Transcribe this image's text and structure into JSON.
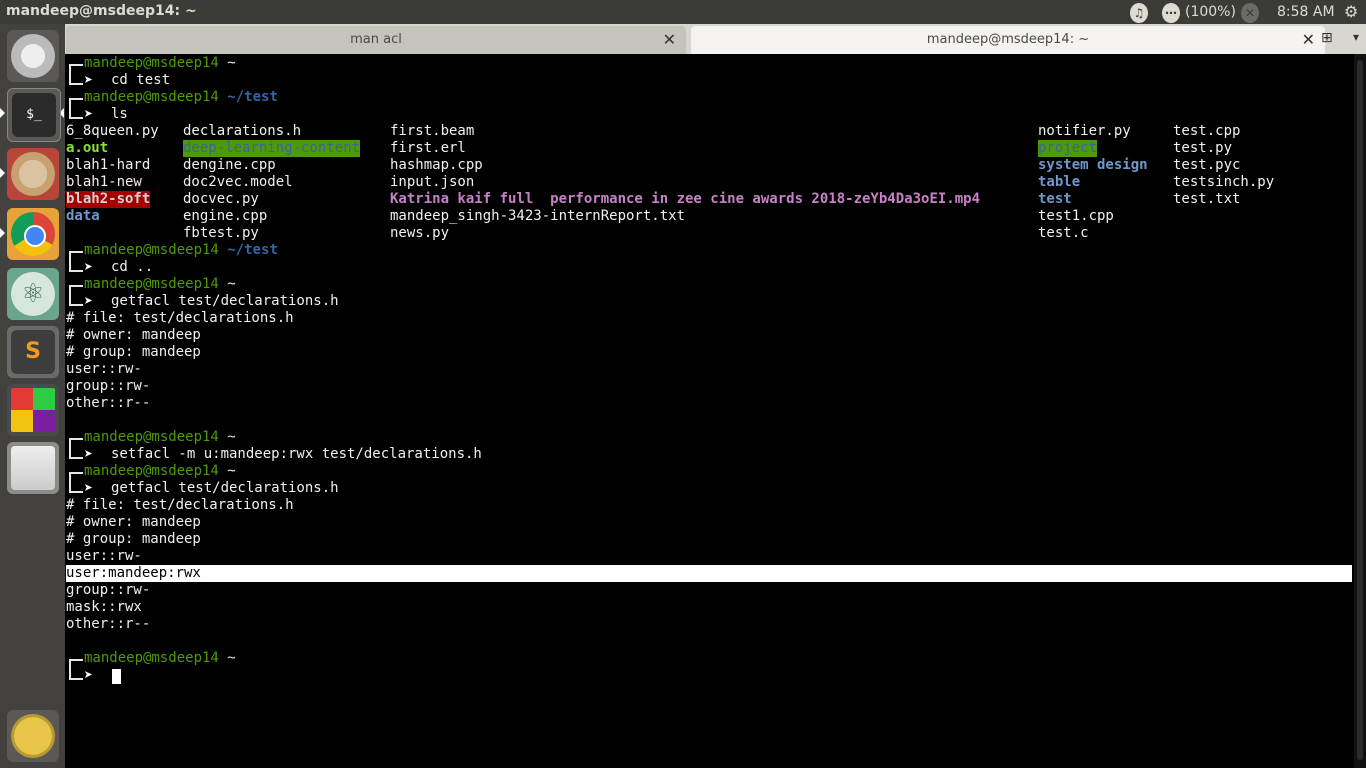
{
  "topbar": {
    "window_title": "mandeep@msdeep14: ~",
    "battery": "(100%)",
    "clock": "8:58 AM"
  },
  "launcher": {
    "items": [
      "ubuntu-dash-icon",
      "terminal-icon",
      "files-icon",
      "chrome-icon",
      "atom-icon",
      "sublime-text-icon",
      "rubiks-cube-icon",
      "drive-icon",
      "trash-icon"
    ]
  },
  "tabs": [
    {
      "label": "man acl"
    },
    {
      "label": "mandeep@msdeep14: ~"
    }
  ],
  "prompts": [
    {
      "user": "mandeep@msdeep14",
      "path": "~",
      "command": "cd test"
    },
    {
      "user": "mandeep@msdeep14",
      "path": "~/test",
      "command": "ls"
    },
    {
      "user": "mandeep@msdeep14",
      "path": "~/test",
      "command": "cd .."
    },
    {
      "user": "mandeep@msdeep14",
      "path": "~",
      "command": "getfacl test/declarations.h"
    },
    {
      "user": "mandeep@msdeep14",
      "path": "~",
      "command": "setfacl -m u:mandeep:rwx test/declarations.h"
    },
    {
      "user": "mandeep@msdeep14",
      "path": "~",
      "command": "getfacl test/declarations.h"
    },
    {
      "user": "mandeep@msdeep14",
      "path": "~",
      "command": ""
    }
  ],
  "ls_output": {
    "col1": [
      "6_8queen.py",
      "a.out",
      "blah1-hard",
      "blah1-new",
      "blah2-soft",
      "data"
    ],
    "col2": [
      "declarations.h",
      "deep-learning-content",
      "dengine.cpp",
      "doc2vec.model",
      "docvec.py",
      "engine.cpp",
      "fbtest.py"
    ],
    "col3": [
      "first.beam",
      "first.erl",
      "hashmap.cpp",
      "input.json",
      "Katrina kaif full  performance in zee cine awards 2018-zeYb4Da3oEI.mp4",
      "mandeep_singh-3423-internReport.txt",
      "news.py"
    ],
    "col4": [
      "notifier.py",
      "project",
      "system design",
      "table",
      "test",
      "test1.cpp",
      "test.c"
    ],
    "col5": [
      "test.cpp",
      "test.py",
      "test.pyc",
      "testsinch.py",
      "test.txt"
    ]
  },
  "getfacl1": [
    "# file: test/declarations.h",
    "# owner: mandeep",
    "# group: mandeep",
    "user::rw-",
    "group::rw-",
    "other::r--"
  ],
  "getfacl2": [
    "# file: test/declarations.h",
    "# owner: mandeep",
    "# group: mandeep",
    "user::rw-",
    "user:mandeep:rwx",
    "group::rw-",
    "mask::rwx",
    "other::r--"
  ],
  "colors": {
    "prompt_user": "#4e9a06",
    "prompt_path": "#3465a4",
    "terminal_bg": "#000000",
    "highlight_row": "#ffffff"
  }
}
